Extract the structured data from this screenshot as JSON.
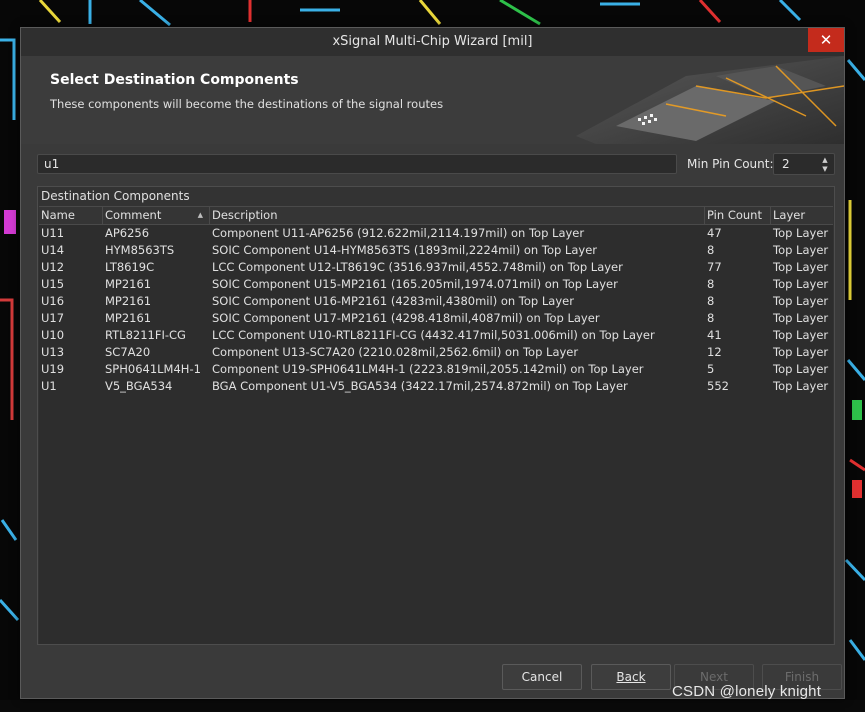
{
  "window": {
    "title": "xSignal Multi-Chip Wizard [mil]",
    "close_glyph": "✕"
  },
  "header": {
    "title": "Select Destination Components",
    "subtitle": "These components will become the destinations of the signal routes"
  },
  "search": {
    "value": "u1"
  },
  "min_pin_count": {
    "label": "Min Pin Count:",
    "value": "2"
  },
  "table": {
    "group_title": "Destination Components",
    "columns": [
      "Name",
      "Comment",
      "Description",
      "Pin Count",
      "Layer"
    ],
    "sorted_column": "Comment",
    "rows": [
      {
        "name": "U11",
        "comment": "AP6256",
        "description": "Component U11-AP6256 (912.622mil,2114.197mil) on Top Layer",
        "pins": "47",
        "layer": "Top Layer"
      },
      {
        "name": "U14",
        "comment": "HYM8563TS",
        "description": "SOIC Component U14-HYM8563TS (1893mil,2224mil) on Top Layer",
        "pins": "8",
        "layer": "Top Layer"
      },
      {
        "name": "U12",
        "comment": "LT8619C",
        "description": "LCC Component U12-LT8619C (3516.937mil,4552.748mil) on Top Layer",
        "pins": "77",
        "layer": "Top Layer"
      },
      {
        "name": "U15",
        "comment": "MP2161",
        "description": "SOIC Component U15-MP2161 (165.205mil,1974.071mil) on Top Layer",
        "pins": "8",
        "layer": "Top Layer"
      },
      {
        "name": "U16",
        "comment": "MP2161",
        "description": "SOIC Component U16-MP2161 (4283mil,4380mil) on Top Layer",
        "pins": "8",
        "layer": "Top Layer"
      },
      {
        "name": "U17",
        "comment": "MP2161",
        "description": "SOIC Component U17-MP2161 (4298.418mil,4087mil) on Top Layer",
        "pins": "8",
        "layer": "Top Layer"
      },
      {
        "name": "U10",
        "comment": "RTL8211FI-CG",
        "description": "LCC Component U10-RTL8211FI-CG (4432.417mil,5031.006mil) on Top Layer",
        "pins": "41",
        "layer": "Top Layer"
      },
      {
        "name": "U13",
        "comment": "SC7A20",
        "description": "Component U13-SC7A20 (2210.028mil,2562.6mil) on Top Layer",
        "pins": "12",
        "layer": "Top Layer"
      },
      {
        "name": "U19",
        "comment": "SPH0641LM4H-1",
        "description": "Component U19-SPH0641LM4H-1 (2223.819mil,2055.142mil) on Top Layer",
        "pins": "5",
        "layer": "Top Layer"
      },
      {
        "name": "U1",
        "comment": "V5_BGA534",
        "description": "BGA Component U1-V5_BGA534 (3422.17mil,2574.872mil) on Top Layer",
        "pins": "552",
        "layer": "Top Layer"
      }
    ]
  },
  "buttons": {
    "cancel": "Cancel",
    "back": "Back",
    "next": "Next",
    "finish": "Finish"
  },
  "watermark": "CSDN @lonely knight",
  "colors": {
    "dialog_bg": "#3a3a3a",
    "close_red": "#c42b1c",
    "header_accent": "#f0a020"
  }
}
